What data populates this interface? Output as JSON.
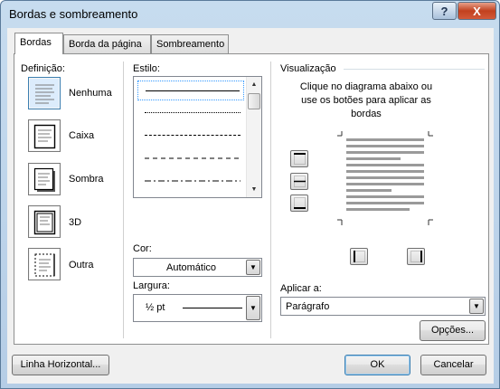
{
  "window": {
    "title": "Bordas e sombreamento",
    "help_label": "?",
    "close_label": "X"
  },
  "tabs": [
    {
      "label": "Bordas",
      "active": true
    },
    {
      "label": "Borda da página",
      "active": false
    },
    {
      "label": "Sombreamento",
      "active": false
    }
  ],
  "definicao": {
    "label": "Definição:",
    "options": [
      {
        "label": "Nenhuma",
        "icon": "border-none-icon",
        "selected": true
      },
      {
        "label": "Caixa",
        "icon": "border-box-icon",
        "selected": false
      },
      {
        "label": "Sombra",
        "icon": "border-shadow-icon",
        "selected": false
      },
      {
        "label": "3D",
        "icon": "border-3d-icon",
        "selected": false
      },
      {
        "label": "Outra",
        "icon": "border-custom-icon",
        "selected": false
      }
    ]
  },
  "estilo": {
    "label": "Estilo:",
    "styles": [
      "solid",
      "dotted",
      "dashed-small",
      "dashed-large",
      "dash-dot"
    ]
  },
  "cor": {
    "label": "Cor:",
    "value": "Automático"
  },
  "largura": {
    "label": "Largura:",
    "value": "½ pt"
  },
  "visualizacao": {
    "label": "Visualização",
    "instructions": [
      "Clique no diagrama abaixo ou",
      "use os botões para aplicar as",
      "bordas"
    ]
  },
  "aplicar": {
    "label": "Aplicar a:",
    "value": "Parágrafo"
  },
  "buttons": {
    "opcoes": "Opções...",
    "linha_horizontal": "Linha Horizontal...",
    "ok": "OK",
    "cancelar": "Cancelar"
  },
  "colors": {
    "title_bg": "#c4daef",
    "selected_border": "#3c7fb1",
    "panel_bg": "#ffffff"
  }
}
